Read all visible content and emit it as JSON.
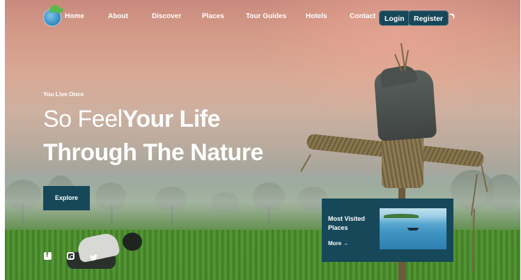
{
  "nav": {
    "links": [
      "Home",
      "About",
      "Discover",
      "Places",
      "Tour Guides",
      "Hotels",
      "Contact"
    ],
    "login_label": "Login",
    "register_label": "Register",
    "theme_icon": "moon-icon",
    "logo_icon": "globe-leaf-icon"
  },
  "hero": {
    "tagline": "You Live Once",
    "headline_light": "So Feel",
    "headline_bold": "Your Life",
    "headline_line2": "Through The Nature",
    "explore_label": "Explore"
  },
  "social": {
    "icons": [
      "facebook-icon",
      "instagram-icon",
      "twitter-icon"
    ]
  },
  "card": {
    "title": "Most Visited Places",
    "more_label": "More",
    "more_arrow": "→"
  },
  "colors": {
    "accent": "#16485a",
    "text": "#ffffff"
  }
}
